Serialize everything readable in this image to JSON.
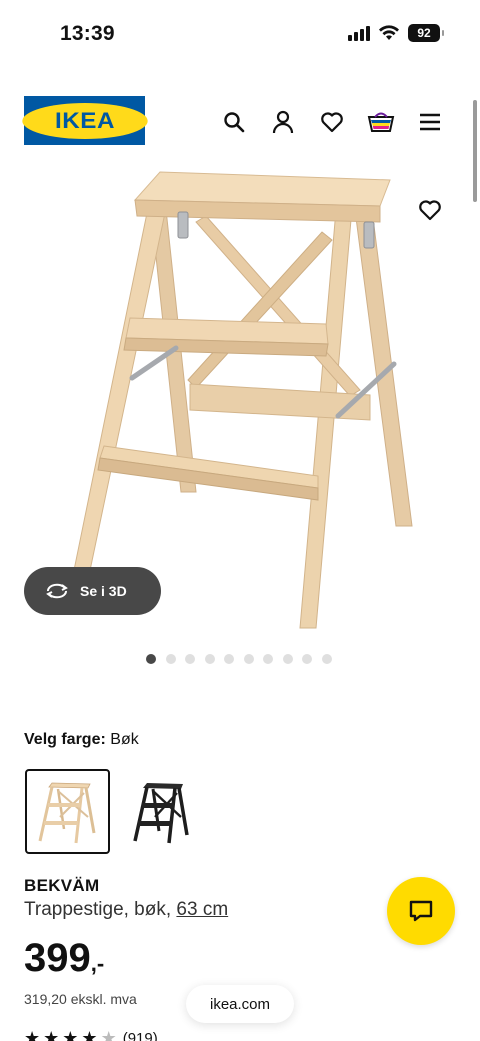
{
  "status_bar": {
    "time": "13:39",
    "battery": "92"
  },
  "header": {
    "logo_text": "IKEA",
    "icons": [
      "search-icon",
      "account-icon",
      "heart-icon",
      "cart-icon",
      "menu-icon"
    ]
  },
  "colors": {
    "ikea_blue": "#0058a3",
    "ikea_yellow": "#ffda1a",
    "dark_pill": "#484848"
  },
  "gallery": {
    "view_3d_label": "Se i 3D",
    "dots_total": 10,
    "active_index": 0
  },
  "variant": {
    "label": "Velg farge:",
    "selected_value": "Bøk",
    "options": [
      "beech",
      "black"
    ]
  },
  "product": {
    "name": "BEKVÄM",
    "description": "Trappestige, bøk,",
    "size_link": "63 cm",
    "price_main": "399",
    "price_suffix": ",-",
    "price_ex_vat": "319,20 ekskl. mva",
    "rating_count": "(919)",
    "rating_value": 4.5
  },
  "browser": {
    "url": "ikea.com"
  }
}
